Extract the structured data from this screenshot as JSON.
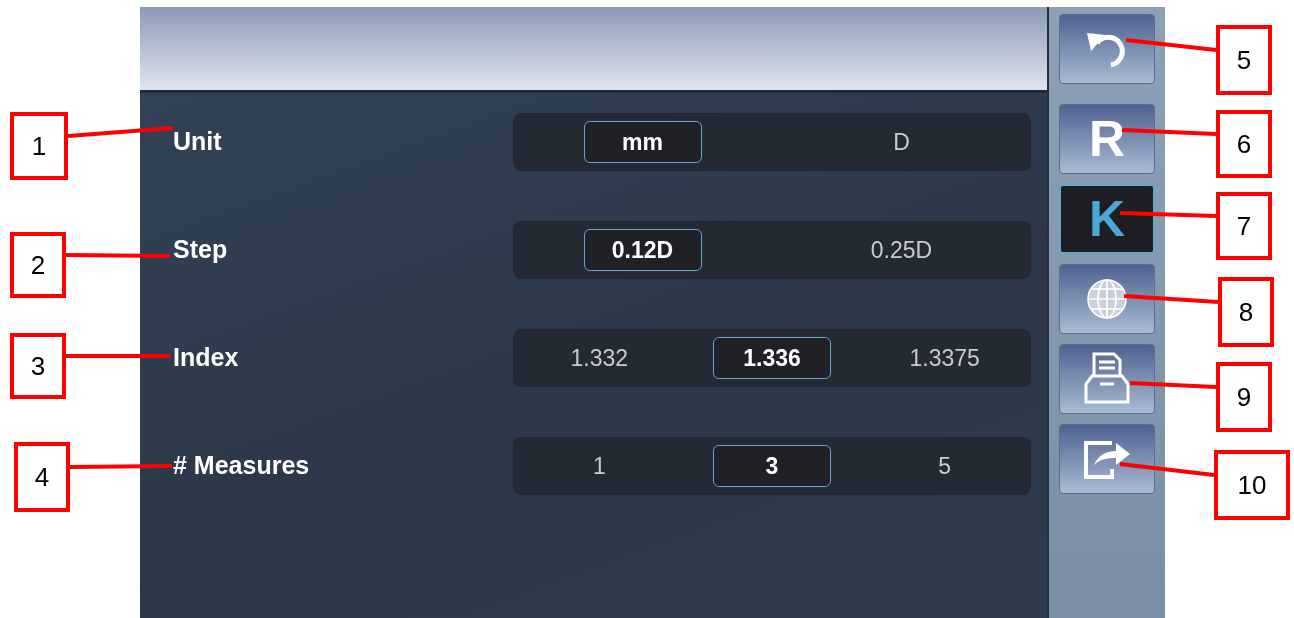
{
  "settings": [
    {
      "label": "Unit",
      "options": [
        {
          "text": "mm",
          "selected": true
        },
        {
          "text": "D",
          "selected": false
        }
      ]
    },
    {
      "label": "Step",
      "options": [
        {
          "text": "0.12D",
          "selected": true
        },
        {
          "text": "0.25D",
          "selected": false
        }
      ]
    },
    {
      "label": "Index",
      "options": [
        {
          "text": "1.332",
          "selected": false
        },
        {
          "text": "1.336",
          "selected": true
        },
        {
          "text": "1.3375",
          "selected": false
        }
      ]
    },
    {
      "label": "# Measures",
      "options": [
        {
          "text": "1",
          "selected": false
        },
        {
          "text": "3",
          "selected": true
        },
        {
          "text": "5",
          "selected": false
        }
      ]
    }
  ],
  "sidebar": {
    "items": [
      {
        "kind": "undo",
        "selected": false
      },
      {
        "kind": "letter",
        "text": "R",
        "selected": false
      },
      {
        "kind": "letter",
        "text": "K",
        "selected": true
      },
      {
        "kind": "globe",
        "selected": false
      },
      {
        "kind": "print",
        "selected": false
      },
      {
        "kind": "export",
        "selected": false
      }
    ]
  },
  "callouts": [
    "1",
    "2",
    "3",
    "4",
    "5",
    "6",
    "7",
    "8",
    "9",
    "10"
  ]
}
